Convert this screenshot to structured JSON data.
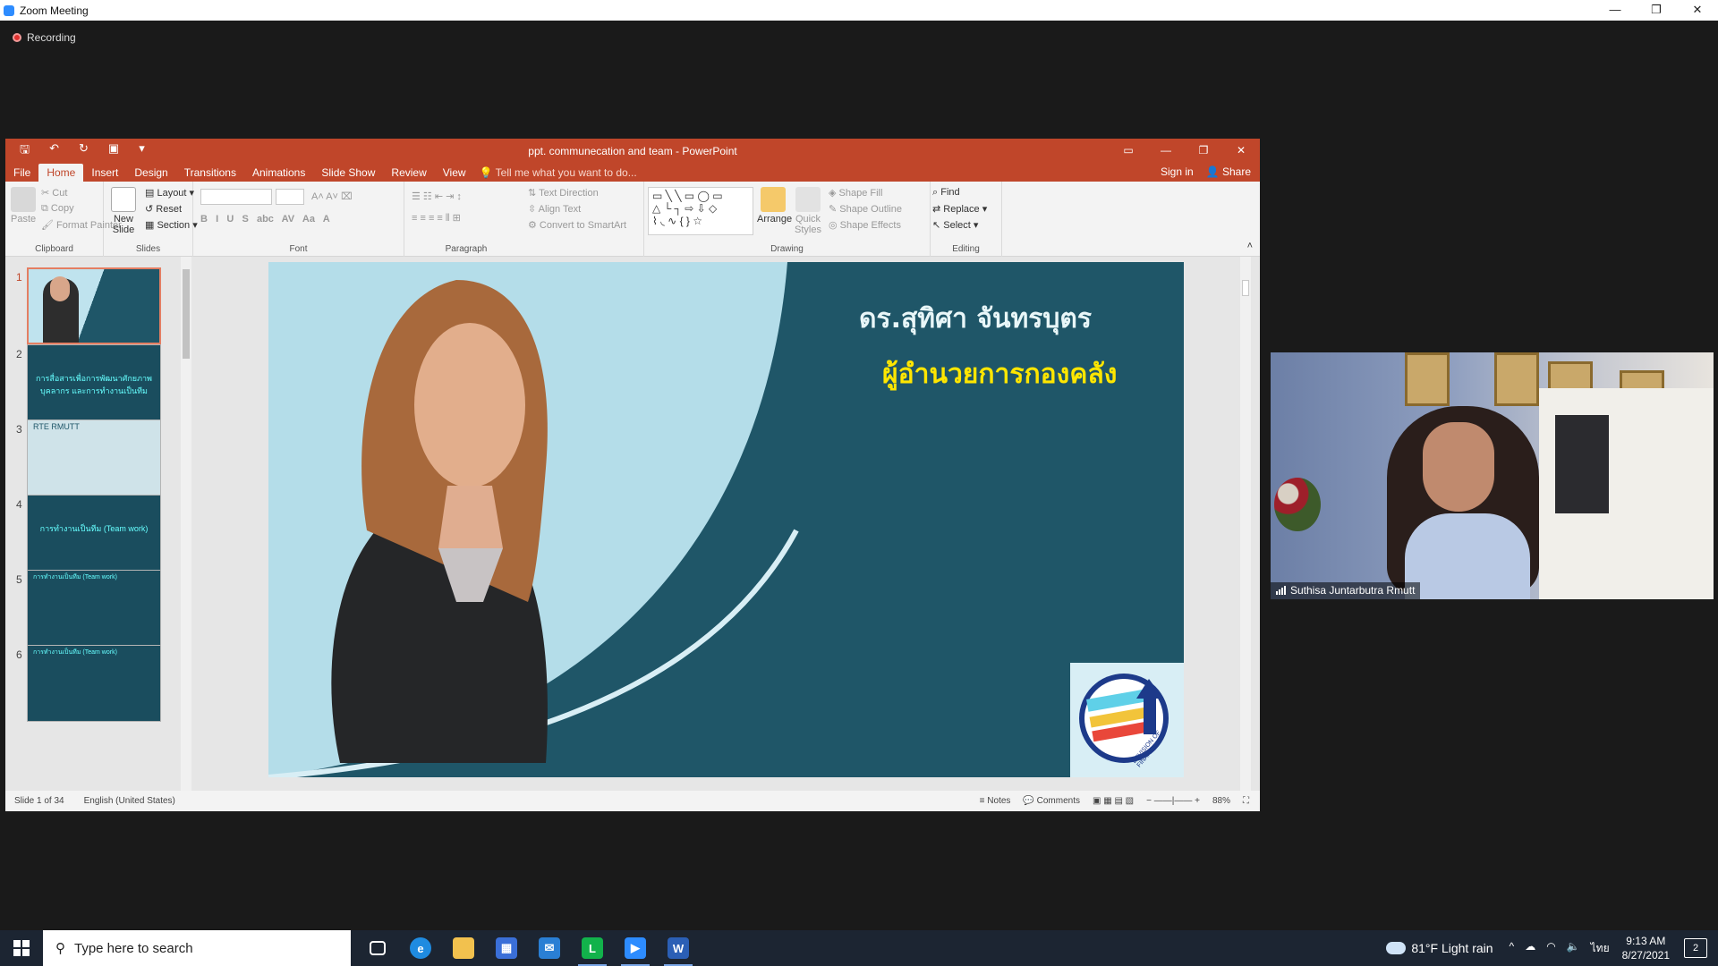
{
  "zoom": {
    "window_title": "Zoom Meeting",
    "controls": [
      "—",
      "❐",
      "✕"
    ],
    "recording_label": "Recording"
  },
  "ppt": {
    "doc_title": "ppt. communecation and team - PowerPoint",
    "tabs": [
      "File",
      "Home",
      "Insert",
      "Design",
      "Transitions",
      "Animations",
      "Slide Show",
      "Review",
      "View"
    ],
    "active_tab": "Home",
    "tell_me": "Tell me what you want to do...",
    "sign_in": "Sign in",
    "share": "Share",
    "ribbon": {
      "clipboard": {
        "label": "Clipboard",
        "paste": "Paste",
        "cut": "Cut",
        "copy": "Copy",
        "format_painter": "Format Painter"
      },
      "slides": {
        "label": "Slides",
        "new_slide": "New Slide",
        "layout": "Layout",
        "reset": "Reset",
        "section": "Section"
      },
      "font": {
        "label": "Font"
      },
      "paragraph": {
        "label": "Paragraph",
        "text_direction": "Text Direction",
        "align_text": "Align Text",
        "convert": "Convert to SmartArt"
      },
      "drawing": {
        "label": "Drawing",
        "arrange": "Arrange",
        "quick_styles": "Quick Styles",
        "shape_fill": "Shape Fill",
        "shape_outline": "Shape Outline",
        "shape_effects": "Shape Effects"
      },
      "editing": {
        "label": "Editing",
        "find": "Find",
        "replace": "Replace",
        "select": "Select"
      }
    },
    "thumbnails": [
      {
        "num": "1",
        "text": ""
      },
      {
        "num": "2",
        "text": "การสื่อสารเพื่อการพัฒนาศักยภาพบุคลากร และการทำงานเป็นทีม"
      },
      {
        "num": "3",
        "text": "RTE RMUTT"
      },
      {
        "num": "4",
        "text": "การทำงานเป็นทีม (Team work)"
      },
      {
        "num": "5",
        "text": "การทำงานเป็นทีม (Team work)"
      },
      {
        "num": "6",
        "text": "การทำงานเป็นทีม (Team work)"
      }
    ],
    "slide": {
      "name": "ดร.สุทิศา จันทรบุตร",
      "role": "ผู้อำนวยการกองคลัง",
      "logo_text": "DEVISION OF FINANCE"
    },
    "status": {
      "slide_of": "Slide 1 of 34",
      "language": "English (United States)",
      "notes": "Notes",
      "comments": "Comments",
      "zoom": "88%"
    }
  },
  "participant": {
    "name": "Suthisa  Juntarbutra Rmutt"
  },
  "taskbar": {
    "search_placeholder": "Type here to search",
    "weather": "81°F  Light rain",
    "lang": "ไทย",
    "time": "9:13 AM",
    "date": "8/27/2021",
    "notifications": "2"
  },
  "colors": {
    "ppt_accent": "#c0462a",
    "slide_bg": "#1f5668",
    "slide_role": "#ffe600"
  }
}
